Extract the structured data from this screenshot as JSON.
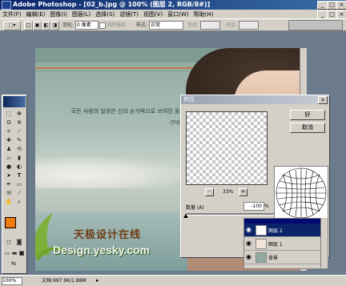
{
  "window": {
    "title": "Adobe Photoshop - [02_b.jpg @ 100% (图层 2, RGB/8#)]"
  },
  "menu": [
    "文件(F)",
    "编辑(E)",
    "图像(I)",
    "图层(L)",
    "选择(S)",
    "滤镜(T)",
    "视图(V)",
    "窗口(W)",
    "帮助(H)"
  ],
  "options": {
    "feather_label": "羽化:",
    "feather_value": "0 像素",
    "antialias_label": "消除锯齿",
    "style_label": "样式:",
    "style_value": "正常",
    "width_label": "宽度:",
    "height_label": "高度:"
  },
  "canvas": {
    "text_line1": "모든 사람의 일생은 신의 손가락으로 쓰여진 동화다",
    "text_line2": "-안데르센-"
  },
  "dialog": {
    "title": "挤压",
    "ok": "好",
    "cancel": "取消",
    "zoom": "33%",
    "zoom_minus": "-",
    "zoom_plus": "+",
    "amount_label": "数量 (A)",
    "amount_value": "-100",
    "amount_unit": "%"
  },
  "layers": [
    {
      "name": "图层 2"
    },
    {
      "name": "图层 1"
    },
    {
      "name": "背景"
    }
  ],
  "watermark": {
    "cn": "天极设计在线",
    "en": "Design.yesky.com"
  },
  "status": {
    "zoom": "100%",
    "doc": "文档:997.9K/1.88M"
  },
  "colors": {
    "foreground": "#f07a10",
    "background": "#ffffff",
    "title_active": "#0a246a"
  }
}
